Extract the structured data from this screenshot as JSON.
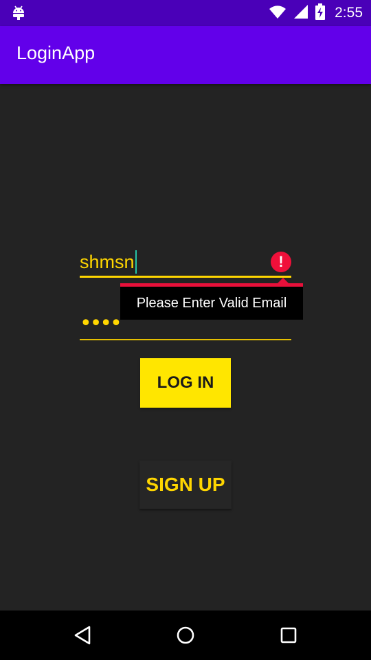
{
  "status_bar": {
    "time": "2:55",
    "icons": [
      "android-icon",
      "wifi-icon",
      "signal-icon",
      "battery-charging-icon"
    ],
    "color": "#4a00b8"
  },
  "app_bar": {
    "title": "LoginApp",
    "color": "#6200ea"
  },
  "email_field": {
    "value": "shmsn",
    "has_error": true,
    "icon": "error-icon"
  },
  "error_popup": {
    "message": "Please Enter Valid Email",
    "accent_color": "#e8103a"
  },
  "password_field": {
    "masked_value": "••••"
  },
  "buttons": {
    "login_label": "LOG IN",
    "signup_label": "SIGN UP",
    "accent_color": "#ffe600"
  },
  "nav_bar": {
    "icons": [
      "back-icon",
      "home-icon",
      "recents-icon"
    ]
  }
}
